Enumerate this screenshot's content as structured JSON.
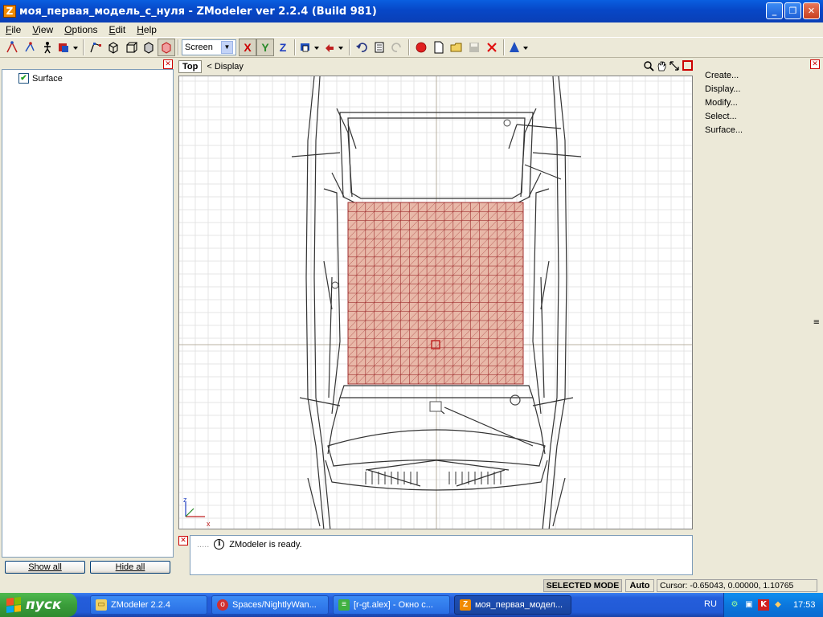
{
  "window": {
    "title": "моя_первая_модель_с_нуля - ZModeler ver 2.2.4 (Build 981)",
    "app_icon_letter": "Z",
    "minimize": "_",
    "maximize": "❐",
    "close": "✕"
  },
  "menu": [
    "File",
    "View",
    "Options",
    "Edit",
    "Help"
  ],
  "toolbar": {
    "coord_select": "Screen",
    "axes": [
      "X",
      "Y",
      "Z"
    ],
    "axis_active": "Y",
    "colors": {
      "x": "#cc0000",
      "y": "#2a8a2a",
      "z": "#2040c0"
    }
  },
  "left_panel": {
    "tree_items": [
      {
        "label": "Surface",
        "checked": true
      }
    ],
    "show_all": "Show all",
    "hide_all": "Hide all"
  },
  "viewport": {
    "view_name": "Top",
    "mode_label": "< Display",
    "axis_label_z": "z",
    "axis_label_x": "x",
    "mesh_color": "#e8b8a8",
    "mesh_line_color": "#a03030"
  },
  "log": {
    "message": "ZModeler is ready."
  },
  "right_panel": {
    "commands": [
      "Create...",
      "Display...",
      "Modify...",
      "Select...",
      "Surface..."
    ]
  },
  "status": {
    "mode": "SELECTED MODE",
    "auto": "Auto",
    "cursor": "Cursor: -0.65043, 0.00000, 1.10765"
  },
  "taskbar": {
    "start": "пуск",
    "tasks": [
      {
        "label": "ZModeler 2.2.4",
        "active": false
      },
      {
        "label": "Spaces/NightlyWan...",
        "active": false
      },
      {
        "label": "[r-gt.alex] - Окно с...",
        "active": false
      },
      {
        "label": "моя_первая_модел...",
        "active": true
      }
    ],
    "lang": "RU",
    "time": "17:53"
  }
}
